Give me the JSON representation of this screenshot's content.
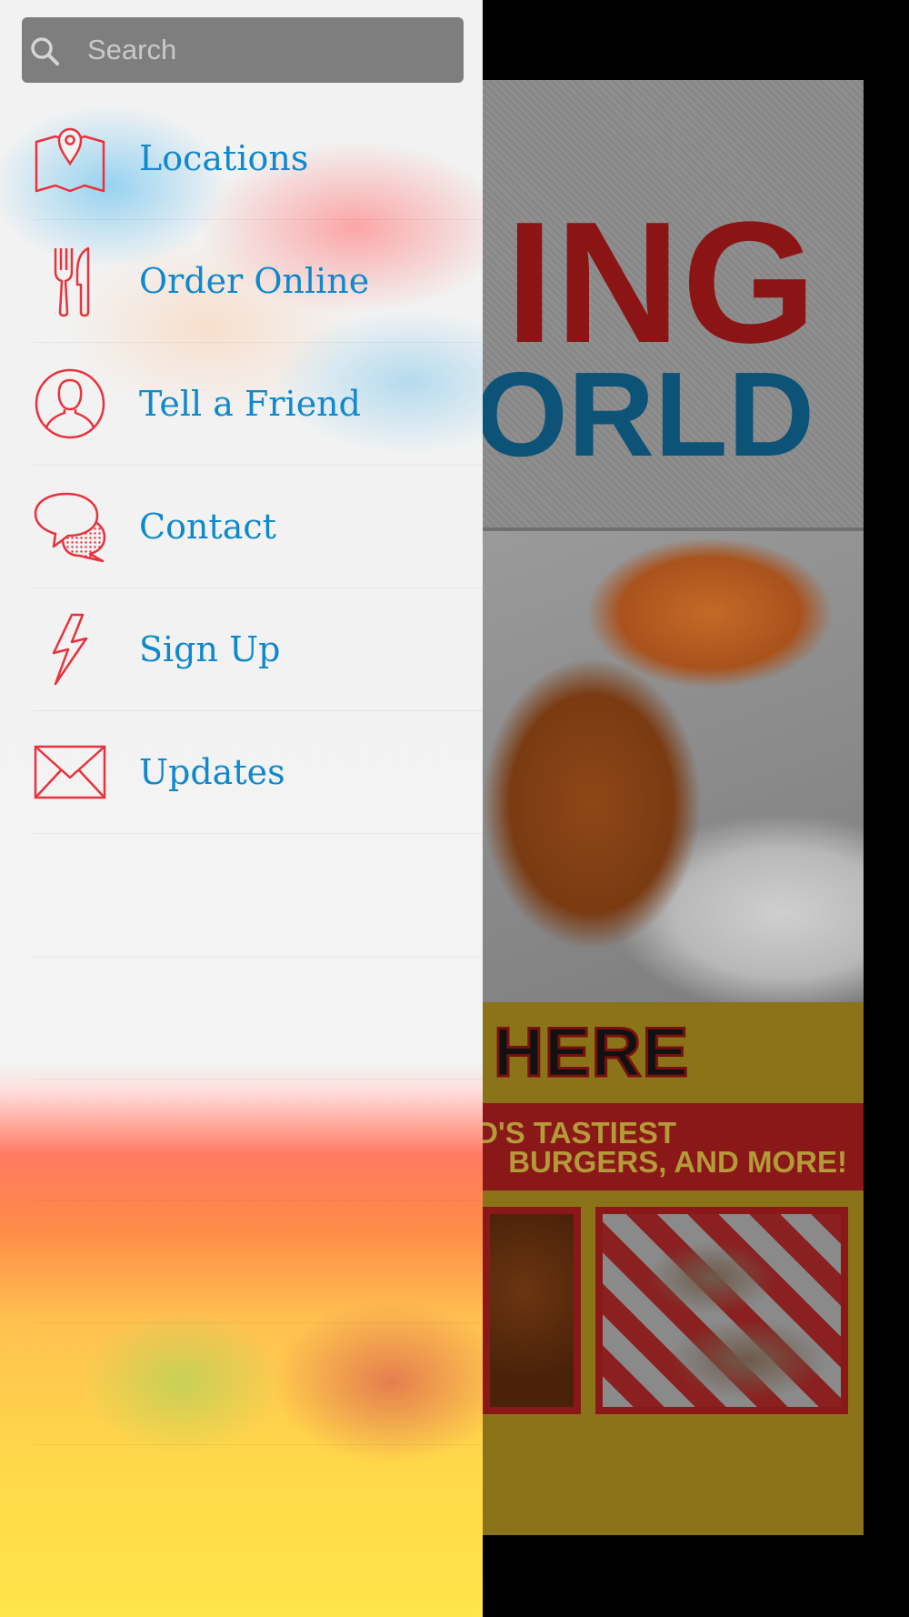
{
  "search": {
    "placeholder": "Search",
    "value": ""
  },
  "menu": {
    "items": [
      {
        "label": "Locations",
        "icon": "map-pin-icon"
      },
      {
        "label": "Order Online",
        "icon": "fork-knife-icon"
      },
      {
        "label": "Tell a Friend",
        "icon": "person-icon"
      },
      {
        "label": "Contact",
        "icon": "chat-bubbles-icon"
      },
      {
        "label": "Sign Up",
        "icon": "lightning-bolt-icon"
      },
      {
        "label": "Updates",
        "icon": "envelope-icon"
      }
    ]
  },
  "background_app": {
    "logo_line1": "ING",
    "logo_line2": "VORLD",
    "headline": "HERE",
    "banner_line1": "D'S TASTIEST",
    "banner_line2": "BURGERS, AND MORE!"
  },
  "colors": {
    "label_blue": "#0f88cc",
    "icon_red": "#e8323c",
    "search_bg": "#7e7e7e"
  }
}
